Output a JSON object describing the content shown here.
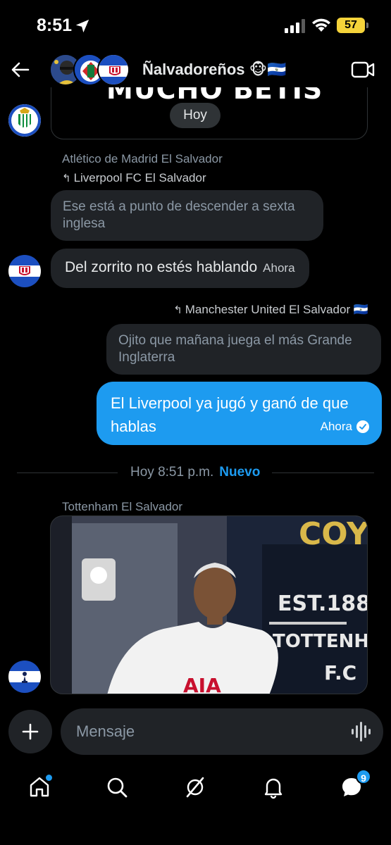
{
  "status_bar": {
    "time": "8:51",
    "battery": "57"
  },
  "header": {
    "title": "Ñalvadoreños 🐵🇸🇻"
  },
  "messages": {
    "prev_card_text": "MUCHO BETIS",
    "day_label": "Hoy",
    "msg1": {
      "sender": "Atlético de Madrid El Salvador",
      "reply_to": "Liverpool FC El Salvador",
      "quoted_text": "Ese está a punto de descender a sexta inglesa",
      "text": "Del zorrito no estés hablando",
      "time": "Ahora"
    },
    "msg2": {
      "reply_to": "Manchester United El Salvador 🇸🇻",
      "quoted_text": "Ojito que mañana juega el más Grande Inglaterra",
      "text": "El Liverpool ya jugó y ganó de que hablas",
      "time": "Ahora"
    },
    "divider": {
      "label": "Hoy 8:51 p.m.",
      "new_label": "Nuevo"
    },
    "msg3": {
      "sender": "Tottenham El Salvador"
    }
  },
  "media_texts": {
    "est": "EST.188",
    "club": "TOTTENHAM H",
    "fc": "F.C",
    "shirt": "AIA",
    "top": "COY"
  },
  "composer": {
    "placeholder": "Mensaje"
  },
  "nav": {
    "messages_badge": "9"
  },
  "colors": {
    "accent": "#1d9bf0",
    "bubble_in": "#202327",
    "background": "#000000",
    "battery": "#f5d33a"
  },
  "icons": [
    "location-arrow-icon",
    "signal-icon",
    "wifi-icon",
    "back-arrow-icon",
    "video-call-icon",
    "reply-icon",
    "check-icon",
    "plus-icon",
    "voice-wave-icon",
    "home-icon",
    "search-icon",
    "grok-icon",
    "bell-icon",
    "messages-icon"
  ]
}
